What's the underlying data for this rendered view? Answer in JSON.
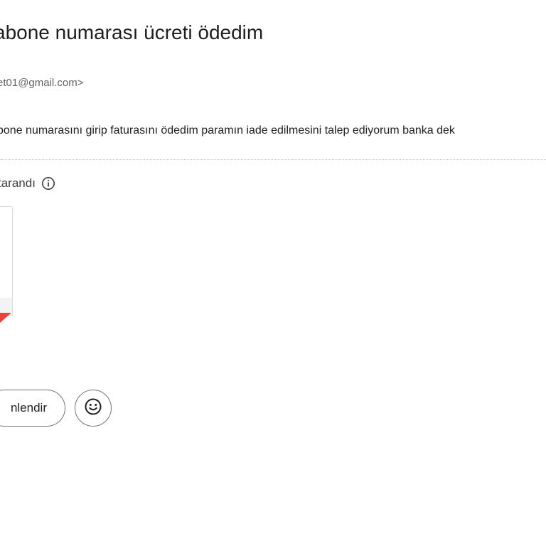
{
  "email": {
    "subject": "abone numarası ücreti ödedim",
    "sender": "et01@gmail.com>",
    "body": "bone numarasını girip faturasını ödedim paramın iade edilmesini talep ediyorum banka dek"
  },
  "attachments": {
    "scan_label": "tarandı",
    "info_icon": "info-icon"
  },
  "actions": {
    "forward_label": "nlendir",
    "emoji_icon": "smiley-icon"
  },
  "colors": {
    "accent_red": "#ea4335",
    "button_border": "#747775",
    "secondary_text": "#5f6368"
  }
}
